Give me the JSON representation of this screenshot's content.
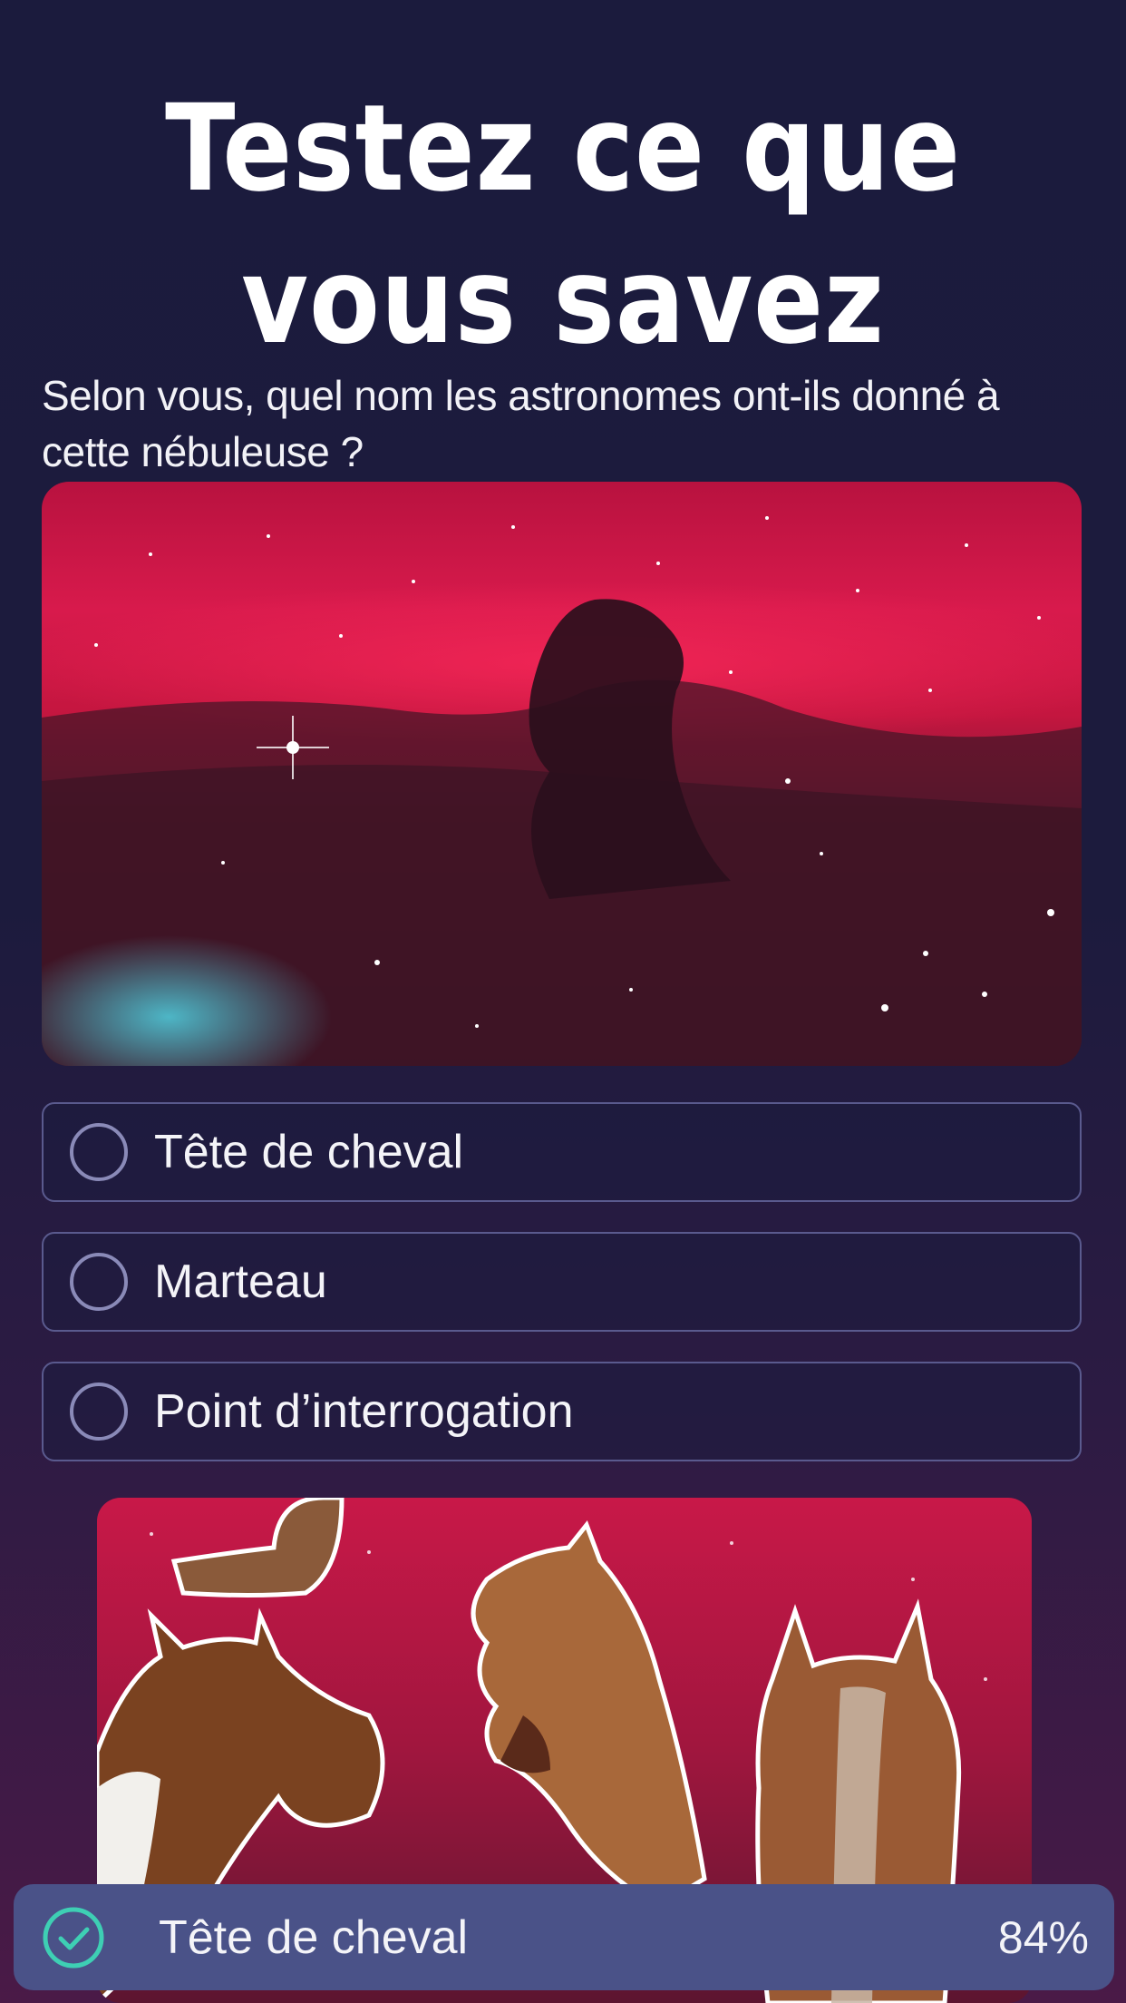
{
  "header": {
    "title_line1": "Testez ce que",
    "title_line2": "vous savez"
  },
  "question": {
    "text": "Selon vous, quel nom les astronomes ont-ils donné à cette nébuleuse ?"
  },
  "nebula_image": {
    "icon": "horsehead-nebula-photo"
  },
  "options": [
    {
      "label": "Tête de cheval"
    },
    {
      "label": "Marteau"
    },
    {
      "label": "Point d’interrogation"
    }
  ],
  "illustration": {
    "icon": "horse-heads-collage"
  },
  "result": {
    "label": "Tête de cheval",
    "percent": "84%",
    "icon": "check-circle-icon"
  },
  "colors": {
    "background_top": "#1b1b3d",
    "background_bottom": "#4a1a47",
    "result_bar": "#4a5288",
    "check_accent": "#3ecfb4",
    "option_border": "#5a5a8e"
  }
}
